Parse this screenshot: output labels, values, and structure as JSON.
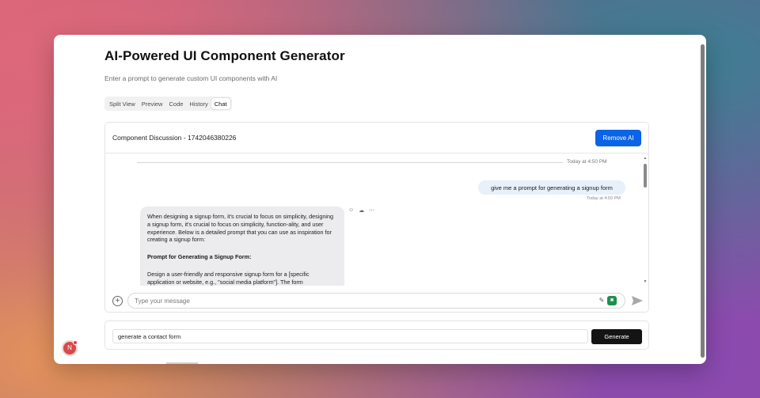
{
  "header": {
    "title": "AI-Powered UI Component Generator",
    "subtitle": "Enter a prompt to generate custom UI components with AI"
  },
  "tabs": [
    {
      "label": "Split View",
      "active": false
    },
    {
      "label": "Preview",
      "active": false
    },
    {
      "label": "Code",
      "active": false
    },
    {
      "label": "History",
      "active": false
    },
    {
      "label": "Chat",
      "active": true
    }
  ],
  "chat": {
    "title": "Component Discussion - 1742046380226",
    "remove_label": "Remove AI",
    "divider_time": "Today at 4:50 PM",
    "user_message": {
      "text": "give me a prompt for generating a signup form",
      "time": "Today at 4:50 PM"
    },
    "ai_message": {
      "intro": "When designing a signup form, it's crucial to focus on simplicity, designing a signup form, it's crucial to focus on simplicity, function-ality, and user experience. Below is a detailed prompt that you can use as inspiration for creating a signup form:",
      "heading": "Prompt for Generating a Signup Form:",
      "body": "Design a user-friendly and responsive signup form for a [specific application or website, e.g., \"social media platform\"]. The form"
    },
    "ai_actions": [
      "☺",
      "☁",
      "⋯"
    ],
    "composer": {
      "placeholder": "Type your message",
      "value": ""
    }
  },
  "generator": {
    "prompt_value": "generate a contact form",
    "generate_label": "Generate"
  },
  "avatar": {
    "initial": "N"
  },
  "colors": {
    "accent_blue": "#0b63e6",
    "generate_black": "#141414",
    "user_bubble": "#e7f0fb",
    "ai_bubble": "#ececee"
  }
}
